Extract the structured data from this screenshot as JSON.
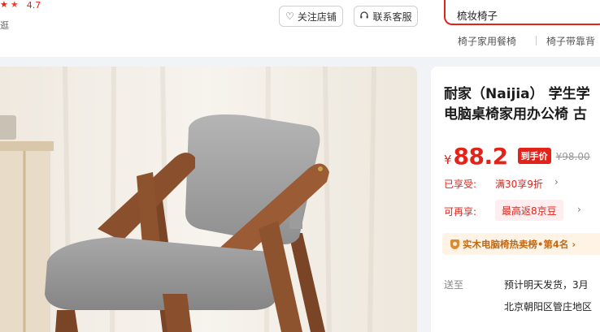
{
  "shop": {
    "rating": "4.7",
    "truncated_link": "逛",
    "follow_label": "关注店铺",
    "service_label": "联系客服"
  },
  "search": {
    "value": "梳妆椅子",
    "hot_words": [
      "椅子家用餐椅",
      "椅子带靠背"
    ]
  },
  "product": {
    "title_line1": "耐家（Naijia） 学生学",
    "title_line2": "电脑桌椅家用办公椅 古",
    "currency": "¥",
    "price": "88.2",
    "price_tag": "到手价",
    "original_price": "¥98.00",
    "enjoyed_label": "已享受:",
    "enjoyed_coupon": "满30享9折",
    "more_label": "可再享:",
    "more_coupon": "最高返8京豆",
    "rank_text": "实木电脑椅热卖榜•第4名",
    "ship_label": "送至",
    "ship_line1": "预计明天发货，3月",
    "ship_line2": "北京朝阳区管庄地区"
  },
  "icons": {
    "heart": "heart-icon",
    "headset": "headset-icon",
    "star": "star-icon",
    "chevron": "chevron-right-icon",
    "rank_badge": "shield-badge-icon"
  },
  "colors": {
    "accent": "#e2231a",
    "rank_text": "#c26a13",
    "rank_bg": "#fff3e6"
  }
}
